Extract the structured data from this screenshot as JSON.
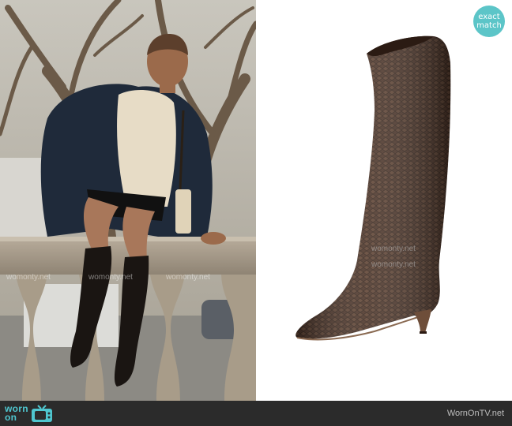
{
  "badge": {
    "line1": "exact",
    "line2": "match"
  },
  "watermark": "womonty.net",
  "footer": {
    "logo_top": "worn",
    "logo_bottom": "on",
    "site": "WornOnTV.net"
  },
  "icons": {
    "badge": "exact-match-badge",
    "logo": "tv-icon"
  },
  "colors": {
    "accent": "#5cc5c8",
    "footer_bg": "#2b2b2b",
    "boot": "#4a3226"
  }
}
